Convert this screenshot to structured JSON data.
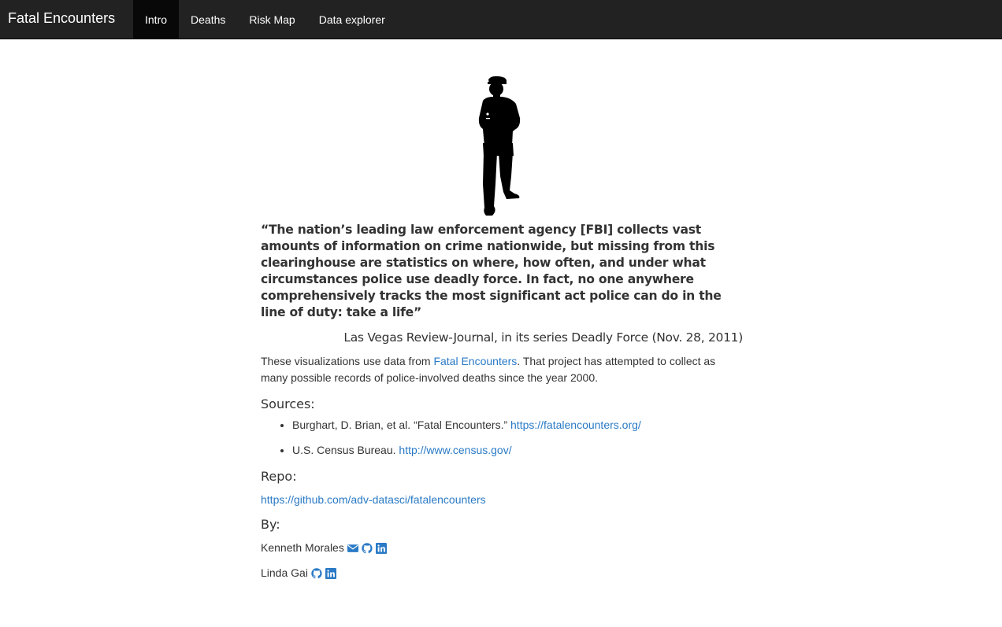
{
  "navbar": {
    "brand": "Fatal Encounters",
    "items": [
      {
        "label": "Intro",
        "active": true
      },
      {
        "label": "Deaths",
        "active": false
      },
      {
        "label": "Risk Map",
        "active": false
      },
      {
        "label": "Data explorer",
        "active": false
      }
    ]
  },
  "quote": {
    "text": "“The nation’s leading law enforcement agency [FBI] collects vast amounts of information on crime nationwide, but missing from this clearinghouse are statistics on where, how often, and under what circumstances police use deadly force. In fact, no one anywhere comprehensively tracks the most significant act police can do in the line of duty: take a life”",
    "source": "Las Vegas Review-Journal, in its series Deadly Force (Nov. 28, 2011)"
  },
  "intro": {
    "before": "These visualizations use data from ",
    "link_text": "Fatal Encounters",
    "after": ". That project has attempted to collect as many possible records of police-involved deaths since the year 2000."
  },
  "sources": {
    "heading": "Sources:",
    "items": [
      {
        "text": "Burghart, D. Brian, et al. “Fatal Encounters.” ",
        "link": "https://fatalencounters.org/"
      },
      {
        "text": "U.S. Census Bureau. ",
        "link": "http://www.census.gov/"
      }
    ]
  },
  "repo": {
    "heading": "Repo:",
    "link": "https://github.com/adv-datasci/fatalencounters"
  },
  "by": {
    "heading": "By:",
    "authors": [
      {
        "name": "Kenneth Morales",
        "icons": [
          "envelope-icon",
          "github-icon",
          "linkedin-icon"
        ]
      },
      {
        "name": "Linda Gai",
        "icons": [
          "github-icon",
          "linkedin-icon"
        ]
      }
    ]
  },
  "colors": {
    "navbar_bg": "#222222",
    "navbar_active_bg": "#080808",
    "link": "#2a7ac6",
    "text": "#333333"
  }
}
